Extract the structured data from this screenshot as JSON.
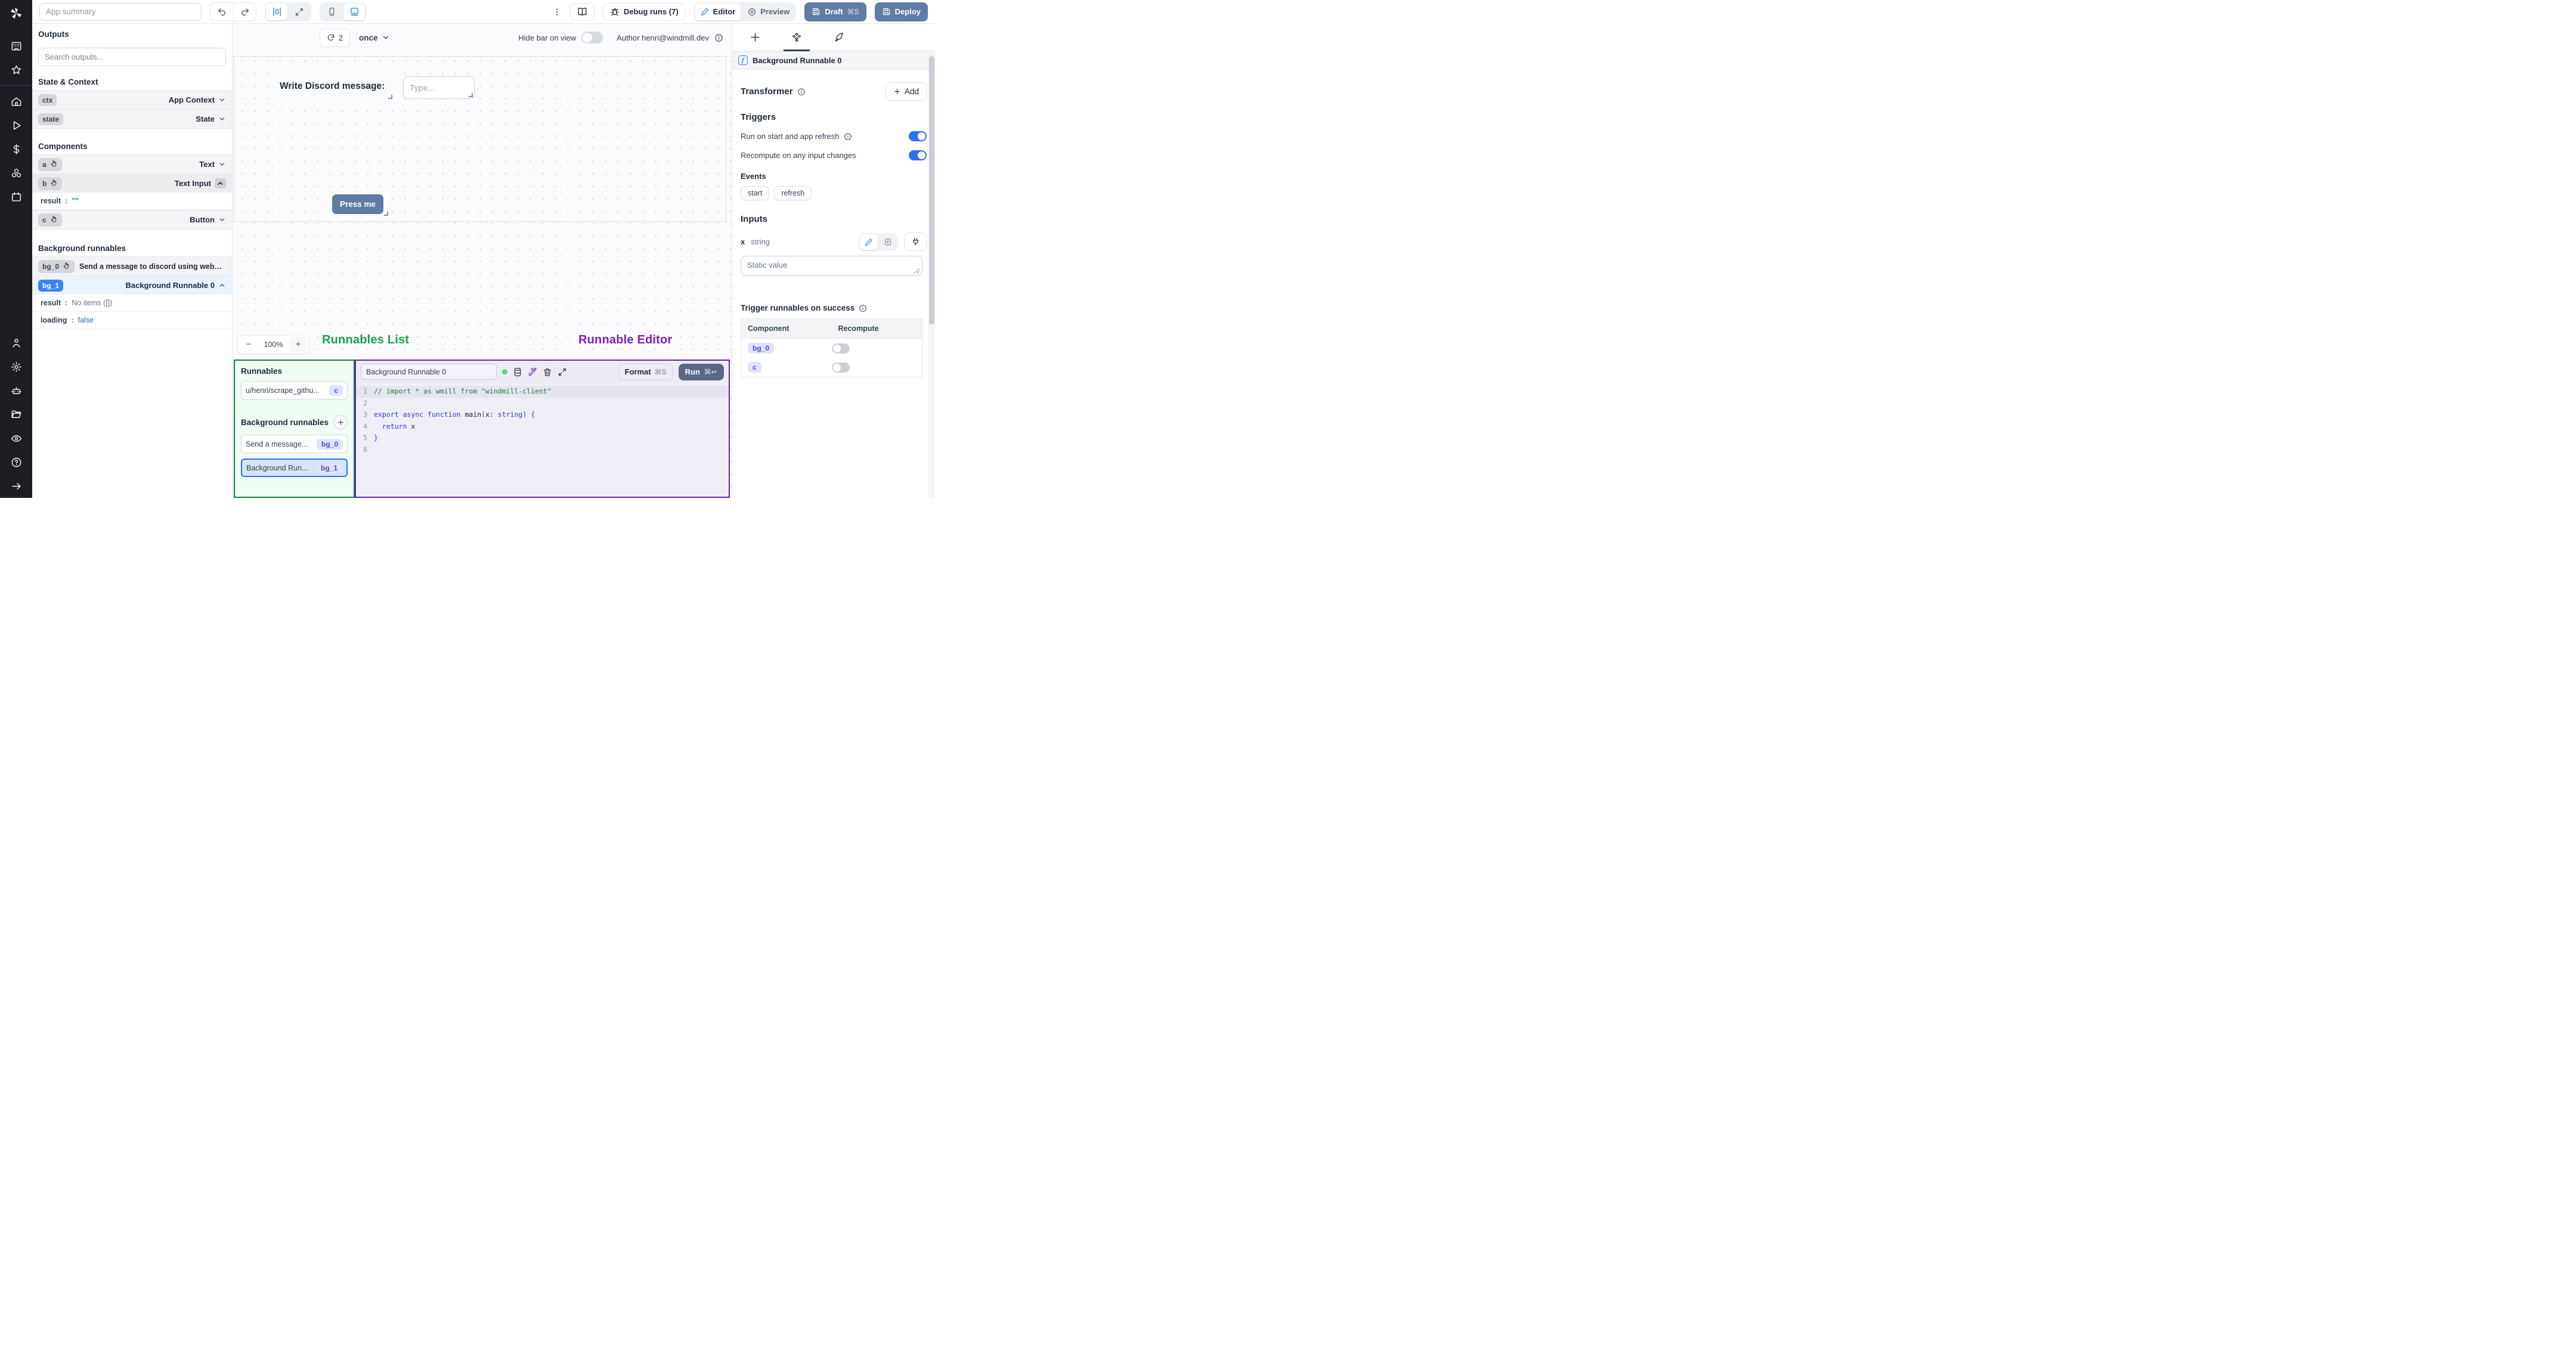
{
  "colors": {
    "accent": "#3b82f6",
    "steel_button": "#5e7ca6",
    "run_button": "#5a6785",
    "green_label": "#16a34a",
    "purple_label": "#7d1fc0",
    "badge_indigo": "#4f46e5",
    "toggle_on": "#2f6fed"
  },
  "topbar": {
    "app_summary_placeholder": "App summary",
    "debug_runs": "Debug runs (7)",
    "editor": "Editor",
    "preview": "Preview",
    "draft": "Draft",
    "draft_shortcut": "⌘S",
    "deploy": "Deploy"
  },
  "canvas_toolbar": {
    "refresh_count": "2",
    "schedule": "once",
    "hide_bar_label": "Hide bar on view",
    "author": "Author henri@windmill.dev"
  },
  "canvas": {
    "text_component": "Write Discord message:",
    "input_placeholder": "Type...",
    "button_label": "Press me",
    "zoom_minus": "−",
    "zoom_value": "100%",
    "zoom_plus": "+",
    "annotations": {
      "runnables_list": "Runnables List",
      "runnable_editor": "Runnable Editor"
    }
  },
  "outputs_panel": {
    "title": "Outputs",
    "search_placeholder": "Search outputs...",
    "state_context": {
      "title": "State & Context",
      "items": [
        {
          "badge": "ctx",
          "type": "App Context"
        },
        {
          "badge": "state",
          "type": "State"
        }
      ]
    },
    "components": {
      "title": "Components",
      "items": [
        {
          "badge": "a",
          "type": "Text"
        },
        {
          "badge": "b",
          "type": "Text Input",
          "result_key": "result",
          "result_colon": ":",
          "result_value": "\"\""
        },
        {
          "badge": "c",
          "type": "Button"
        }
      ]
    },
    "background": {
      "title": "Background runnables",
      "items": [
        {
          "badge": "bg_0",
          "label": "Send a message to discord using webhoo"
        },
        {
          "badge": "bg_1",
          "label": "Background Runnable 0",
          "result_key": "result",
          "result_value": "No items ([])",
          "loading_key": "loading",
          "loading_value": "false",
          "colon": ":"
        }
      ]
    }
  },
  "runnables_panel": {
    "title": "Runnables",
    "item": {
      "label": "u/henri/scrape_githu...",
      "badge": "c"
    },
    "bg_title": "Background runnables",
    "bg_items": [
      {
        "label": "Send a message...",
        "badge": "bg_0"
      },
      {
        "label": "Background Run...",
        "badge": "bg_1"
      }
    ]
  },
  "editor_panel": {
    "name_value": "Background Runnable 0",
    "format": "Format",
    "format_shortcut": "⌘S",
    "run": "Run",
    "run_shortcut": "⌘↵",
    "code_lines": [
      [
        {
          "t": "// import * as wmill from \"windmill-client\"",
          "c": "comment"
        }
      ],
      [],
      [
        {
          "t": "export",
          "c": "kw"
        },
        {
          "t": " ",
          "c": "p"
        },
        {
          "t": "async",
          "c": "kw"
        },
        {
          "t": " ",
          "c": "p"
        },
        {
          "t": "function",
          "c": "kw"
        },
        {
          "t": " main",
          "c": "p"
        },
        {
          "t": "(",
          "c": "kw"
        },
        {
          "t": "x",
          "c": "p"
        },
        {
          "t": ": ",
          "c": "p"
        },
        {
          "t": "string",
          "c": "kw"
        },
        {
          "t": ") {",
          "c": "kw"
        }
      ],
      [
        {
          "t": "  ",
          "c": "p"
        },
        {
          "t": "return",
          "c": "kw"
        },
        {
          "t": " x",
          "c": "p"
        }
      ],
      [
        {
          "t": "}",
          "c": "kw"
        }
      ],
      []
    ]
  },
  "settings_panel": {
    "header": "Background Runnable 0",
    "transformer": "Transformer",
    "add": "Add",
    "triggers": "Triggers",
    "run_on_start": "Run on start and app refresh",
    "recompute_any": "Recompute on any input changes",
    "events": "Events",
    "chips": [
      "start",
      "refresh"
    ],
    "inputs": "Inputs",
    "input_name": "x",
    "input_type": "string",
    "static_placeholder": "Static value",
    "trigger_success": "Trigger runnables on success",
    "table": {
      "headers": [
        "Component",
        "Recompute"
      ],
      "rows": [
        {
          "badge": "bg_0"
        },
        {
          "badge": "c"
        }
      ]
    }
  }
}
